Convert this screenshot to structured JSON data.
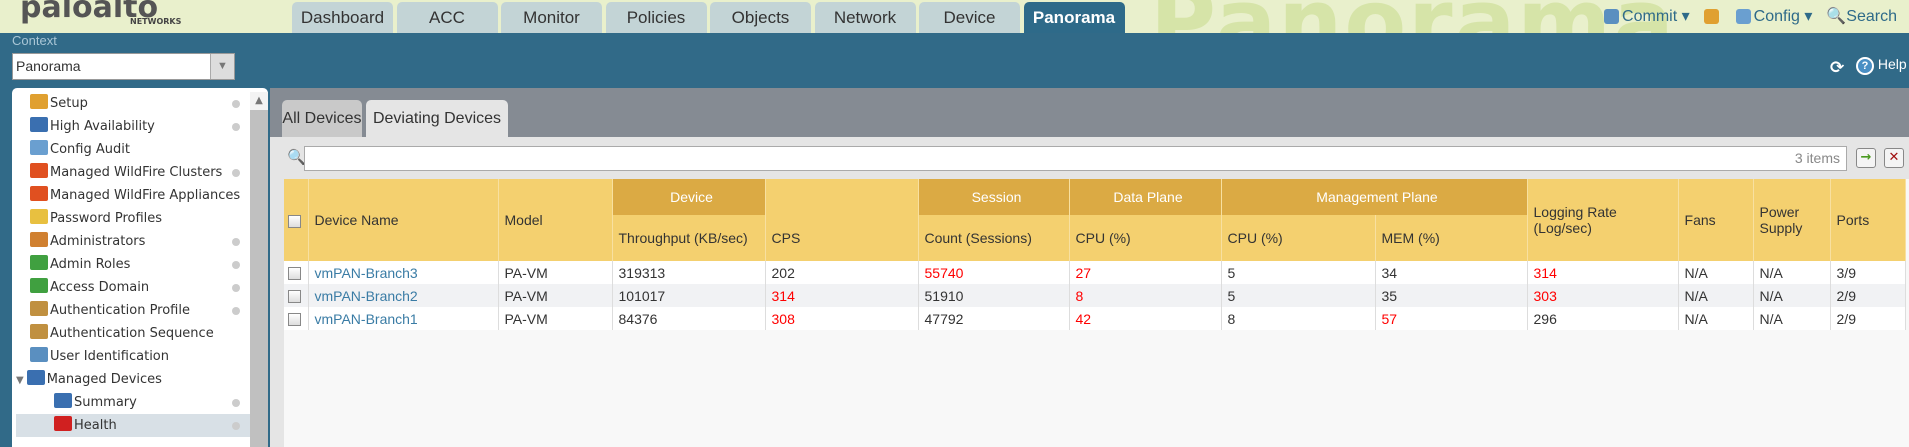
{
  "brand": {
    "name": "paloalto",
    "sub": "NETWORKS"
  },
  "watermark": "Panorama",
  "tabs": [
    "Dashboard",
    "ACC",
    "Monitor",
    "Policies",
    "Objects",
    "Network",
    "Device",
    "Panorama"
  ],
  "active_tab": "Panorama",
  "toolbar": {
    "commit": "Commit",
    "config": "Config",
    "search": "Search",
    "help": "Help"
  },
  "context": {
    "label": "Context",
    "value": "Panorama"
  },
  "sidebar": {
    "items": [
      {
        "label": "Setup",
        "dot": true
      },
      {
        "label": "High Availability",
        "dot": true
      },
      {
        "label": "Config Audit",
        "dot": false
      },
      {
        "label": "Managed WildFire Clusters",
        "dot": true
      },
      {
        "label": "Managed WildFire Appliances",
        "dot": false
      },
      {
        "label": "Password Profiles",
        "dot": false
      },
      {
        "label": "Administrators",
        "dot": true
      },
      {
        "label": "Admin Roles",
        "dot": true
      },
      {
        "label": "Access Domain",
        "dot": true
      },
      {
        "label": "Authentication Profile",
        "dot": true
      },
      {
        "label": "Authentication Sequence",
        "dot": false
      },
      {
        "label": "User Identification",
        "dot": false
      },
      {
        "label": "Managed Devices",
        "dot": false
      },
      {
        "label": "Summary",
        "dot": true
      },
      {
        "label": "Health",
        "dot": true
      }
    ]
  },
  "subtabs": [
    "All Devices",
    "Deviating Devices"
  ],
  "active_subtab": "Deviating Devices",
  "filter": {
    "value": "",
    "count": "3 items"
  },
  "groups": {
    "device": "Device",
    "session": "Session",
    "dataplane": "Data Plane",
    "mgmt": "Management Plane"
  },
  "columns": [
    "Device Name",
    "Model",
    "Throughput (KB/sec)",
    "CPS",
    "Count (Sessions)",
    "CPU (%)",
    "CPU (%)",
    "MEM (%)",
    "Logging Rate (Log/sec)",
    "Fans",
    "Power Supply",
    "Ports"
  ],
  "rows": [
    {
      "cells": [
        "vmPAN-Branch3",
        "PA-VM",
        "319313",
        "202",
        "55740",
        "27",
        "5",
        "34",
        "314",
        "N/A",
        "N/A",
        "3/9"
      ],
      "red": [
        4,
        5,
        8
      ]
    },
    {
      "cells": [
        "vmPAN-Branch2",
        "PA-VM",
        "101017",
        "314",
        "51910",
        "8",
        "5",
        "35",
        "303",
        "N/A",
        "N/A",
        "2/9"
      ],
      "red": [
        3,
        5,
        8
      ]
    },
    {
      "cells": [
        "vmPAN-Branch1",
        "PA-VM",
        "84376",
        "308",
        "47792",
        "42",
        "8",
        "57",
        "296",
        "N/A",
        "N/A",
        "2/9"
      ],
      "red": [
        3,
        5,
        7
      ]
    }
  ],
  "colors": {
    "accent": "#316a88",
    "header": "#f4d06f",
    "group_header": "#dbaa44",
    "alert": "#ff0000",
    "link": "#3a7ca5"
  }
}
